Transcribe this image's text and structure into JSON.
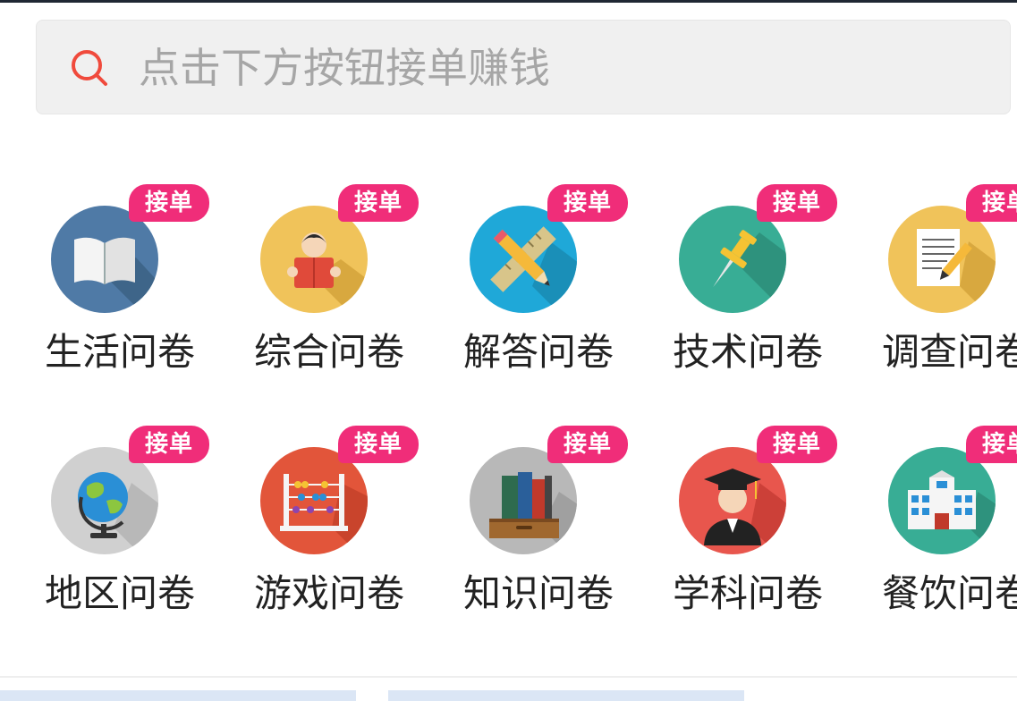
{
  "search": {
    "placeholder": "点击下方按钮接单赚钱",
    "icon": "search-icon"
  },
  "badge_text": "接单",
  "categories": [
    {
      "label": "生活问卷",
      "icon": "book-icon",
      "color": "#4f7aa6"
    },
    {
      "label": "综合问卷",
      "icon": "reader-icon",
      "color": "#f0c35a"
    },
    {
      "label": "解答问卷",
      "icon": "ruler-pencil-icon",
      "color": "#1fa8d8"
    },
    {
      "label": "技术问卷",
      "icon": "pushpin-icon",
      "color": "#38ad95"
    },
    {
      "label": "调查问卷",
      "icon": "notepad-pencil-icon",
      "color": "#f0c35a"
    },
    {
      "label": "地区问卷",
      "icon": "globe-icon",
      "color": "#d0d0d0"
    },
    {
      "label": "游戏问卷",
      "icon": "abacus-icon",
      "color": "#e2553a"
    },
    {
      "label": "知识问卷",
      "icon": "books-drawer-icon",
      "color": "#b8b8b8"
    },
    {
      "label": "学科问卷",
      "icon": "graduate-icon",
      "color": "#e8564d"
    },
    {
      "label": "餐饮问卷",
      "icon": "building-icon",
      "color": "#38ad95"
    }
  ],
  "colors": {
    "badge": "#f02d79",
    "search_icon": "#f04a3c",
    "placeholder_text": "#a6a6a6"
  }
}
